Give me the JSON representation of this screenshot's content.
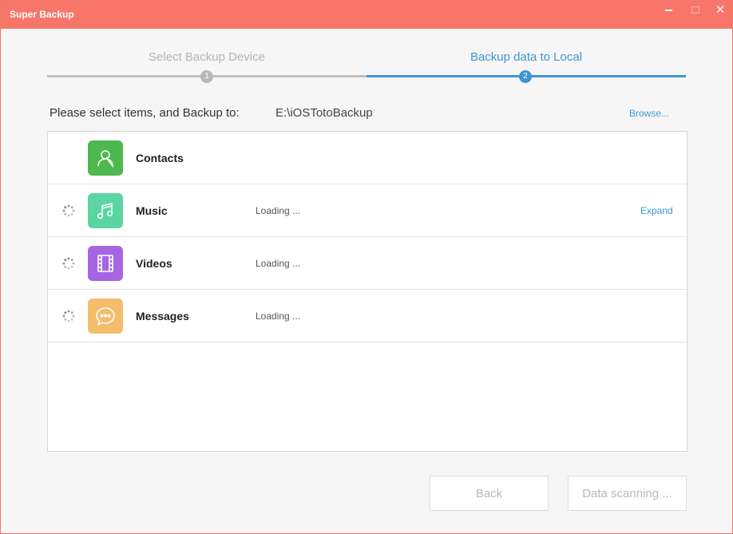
{
  "window": {
    "title": "Super Backup"
  },
  "stepper": {
    "steps": [
      {
        "label": "Select Backup Device",
        "number": "1",
        "state": "done"
      },
      {
        "label": "Backup data to Local",
        "number": "2",
        "state": "active"
      }
    ]
  },
  "destination": {
    "prompt": "Please select items, and Backup to:",
    "path": "E:\\iOSTotoBackup",
    "browse_label": "Browse..."
  },
  "items": [
    {
      "name": "Contacts",
      "status": "",
      "icon": "contacts-icon",
      "color": "#4cb84e",
      "loading": false,
      "expand": ""
    },
    {
      "name": "Music",
      "status": "Loading ...",
      "icon": "music-note-icon",
      "color": "#5bd5a1",
      "loading": true,
      "expand": "Expand"
    },
    {
      "name": "Videos",
      "status": "Loading ...",
      "icon": "film-icon",
      "color": "#a666e3",
      "loading": true,
      "expand": ""
    },
    {
      "name": "Messages",
      "status": "Loading ...",
      "icon": "chat-bubble-icon",
      "color": "#f3bd6c",
      "loading": true,
      "expand": ""
    }
  ],
  "buttons": {
    "back_label": "Back",
    "scan_label": "Data scanning ..."
  },
  "colors": {
    "titlebar": "#f8756a",
    "accent": "#3e96d1",
    "step_inactive": "#b8b8b8"
  }
}
